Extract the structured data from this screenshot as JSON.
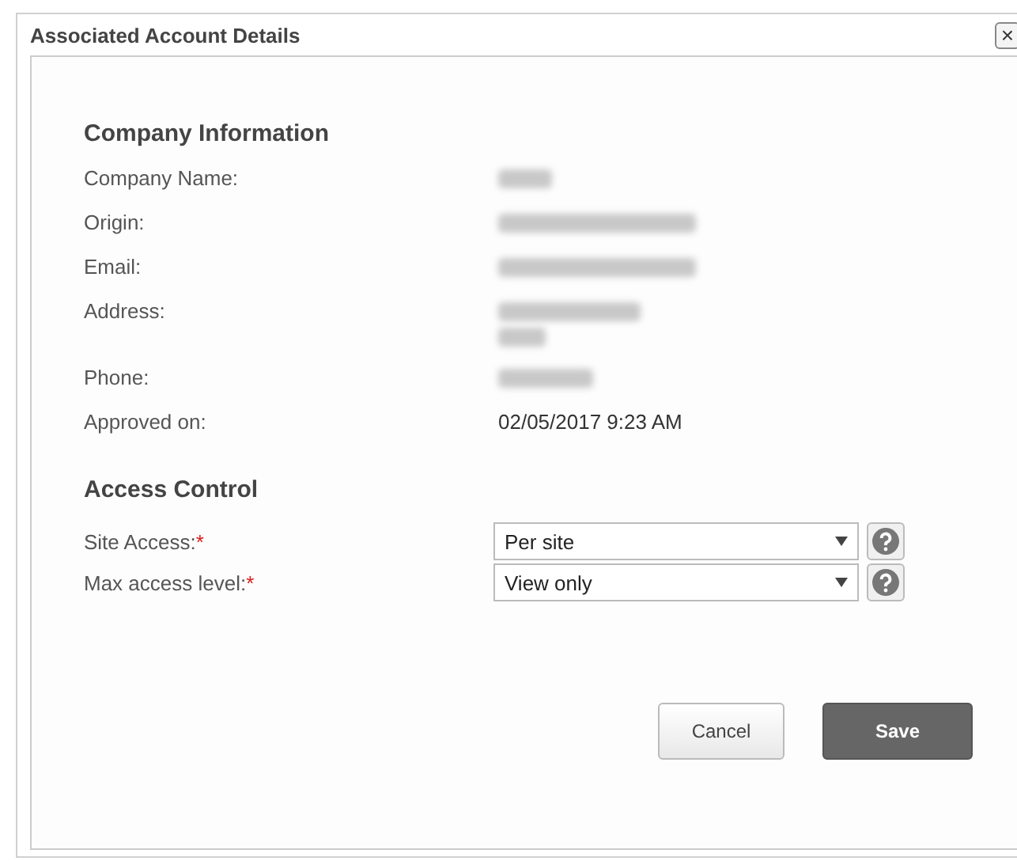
{
  "window": {
    "title": "Associated Account Details",
    "close": "×"
  },
  "company": {
    "heading": "Company Information",
    "rows": [
      {
        "label": "Company Name:",
        "kind": "redacted_short"
      },
      {
        "label": "Origin:",
        "kind": "redacted_long"
      },
      {
        "label": "Email:",
        "kind": "redacted_long"
      },
      {
        "label": "Address:",
        "kind": "redacted_multiline"
      },
      {
        "label": "Phone:",
        "kind": "redacted_medium"
      },
      {
        "label": "Approved on:",
        "kind": "text",
        "value": "02/05/2017 9:23 AM"
      }
    ]
  },
  "access": {
    "heading": "Access Control",
    "fields": [
      {
        "label": "Site Access:",
        "required_mark": "*",
        "value": "Per site"
      },
      {
        "label": "Max access level:",
        "required_mark": "*",
        "value": "View only"
      }
    ]
  },
  "buttons": [
    {
      "label": "Cancel",
      "kind": "secondary"
    },
    {
      "label": "Save",
      "kind": "primary"
    }
  ]
}
